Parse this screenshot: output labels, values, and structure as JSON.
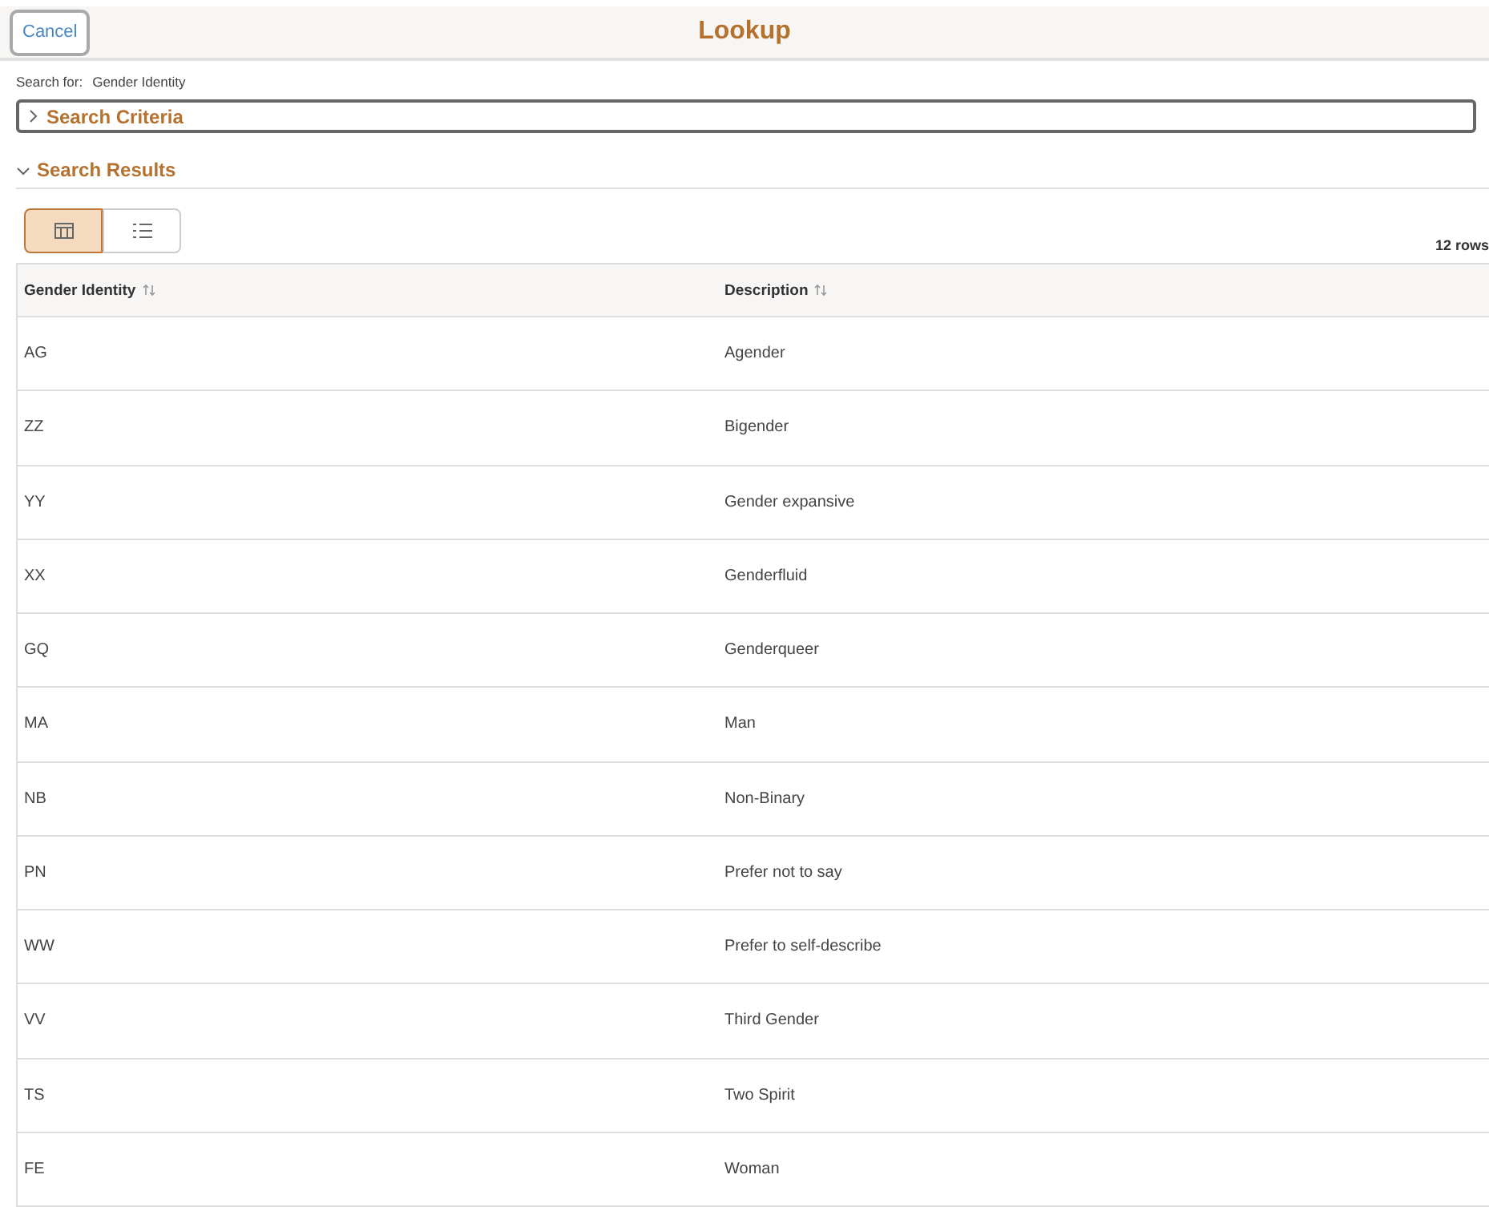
{
  "header": {
    "cancel": "Cancel",
    "title": "Lookup"
  },
  "search_for": {
    "label": "Search for:",
    "value": "Gender Identity"
  },
  "search_criteria": {
    "label": "Search Criteria",
    "expanded": false
  },
  "search_results": {
    "label": "Search Results",
    "expanded": true
  },
  "view_toggle": [
    {
      "kind": "grid",
      "selected": true
    },
    {
      "kind": "list",
      "selected": false
    }
  ],
  "row_count": "12 rows",
  "table": {
    "columns": [
      "Gender Identity",
      "Description"
    ],
    "rows": [
      [
        "AG",
        "Agender"
      ],
      [
        "ZZ",
        "Bigender"
      ],
      [
        "YY",
        "Gender expansive"
      ],
      [
        "XX",
        "Genderfluid"
      ],
      [
        "GQ",
        "Genderqueer"
      ],
      [
        "MA",
        "Man"
      ],
      [
        "NB",
        "Non-Binary"
      ],
      [
        "PN",
        "Prefer not to say"
      ],
      [
        "WW",
        "Prefer to self-describe"
      ],
      [
        "VV",
        "Third Gender"
      ],
      [
        "TS",
        "Two Spirit"
      ],
      [
        "FE",
        "Woman"
      ]
    ]
  }
}
